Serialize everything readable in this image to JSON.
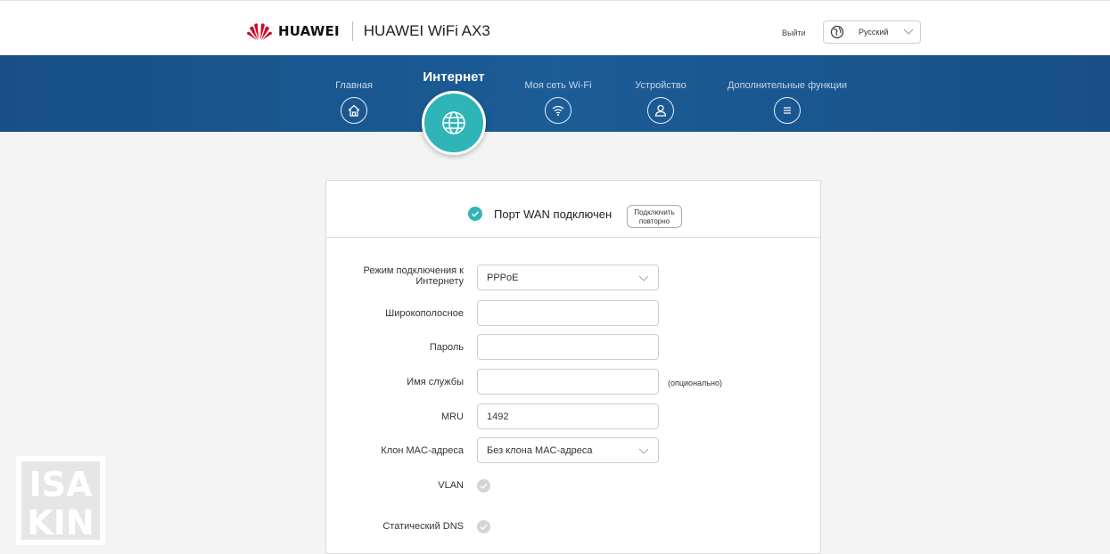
{
  "header": {
    "brand": "HUAWEI",
    "product": "HUAWEI WiFi AX3",
    "logout": "Выйти",
    "language": "Русский",
    "brand_color": "#cf0a2c"
  },
  "nav": {
    "items": [
      {
        "label": "Главная",
        "icon": "home-icon"
      },
      {
        "label": "Интернет",
        "icon": "globe-icon",
        "active": true
      },
      {
        "label": "Моя сеть Wi-Fi",
        "icon": "wifi-icon"
      },
      {
        "label": "Устройство",
        "icon": "user-icon"
      },
      {
        "label": "Дополнительные функции",
        "icon": "menu-icon"
      }
    ],
    "band_color": "#1b5690",
    "active_color": "#2fb5b8"
  },
  "status": {
    "text": "Порт WAN подключен",
    "reconnect_line1": "Подключить",
    "reconnect_line2": "повторно",
    "ok_color": "#2fb5b8"
  },
  "form": {
    "mode_label_line1": "Режим подключения к",
    "mode_label_line2": "Интернету",
    "mode_value": "PPPoE",
    "broadband_label": "Широкополосное",
    "broadband_value": "",
    "password_label": "Пароль",
    "password_value": "",
    "service_label": "Имя службы",
    "service_value": "",
    "service_hint": "(опционально)",
    "mru_label": "MRU",
    "mru_value": "1492",
    "mac_label": "Клон MAC-адреса",
    "mac_value": "Без клона MAC-адреса",
    "vlan_label": "VLAN",
    "dns_label": "Статический DNS"
  },
  "watermark": {
    "line1": "ISA",
    "line2": "KIN"
  }
}
